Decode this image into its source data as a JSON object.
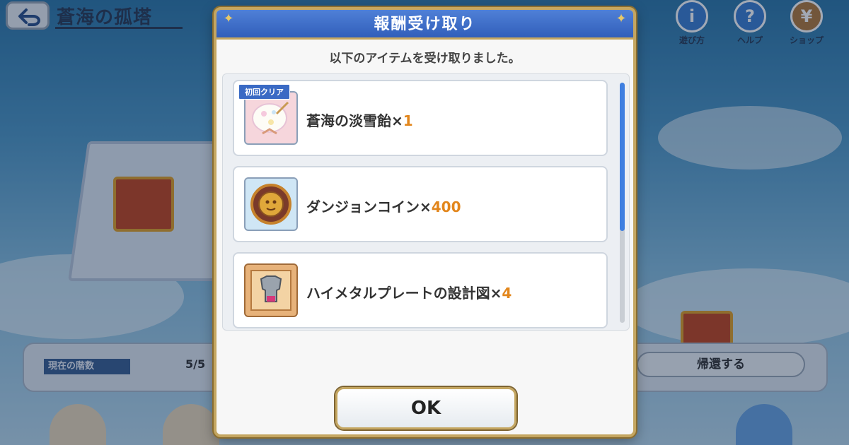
{
  "background": {
    "area_title": "蒼海の孤塔",
    "top_icons": [
      {
        "label": "遊び方",
        "icon": "info-icon",
        "glyph": "i"
      },
      {
        "label": "ヘルプ",
        "icon": "help-icon",
        "glyph": "?"
      },
      {
        "label": "ショップ",
        "icon": "shop-icon",
        "glyph": "¥"
      }
    ],
    "dungeon_label": "現在の階数",
    "dungeon_count": "5/5",
    "retreat_button": "帰還する"
  },
  "modal": {
    "title": "報酬受け取り",
    "subtitle": "以下のアイテムを受け取りました。",
    "ok_label": "OK",
    "items": [
      {
        "name": "蒼海の淡雪飴×",
        "qty": "1",
        "badge": "初回クリア",
        "icon": "snow-candy-icon"
      },
      {
        "name": "ダンジョンコイン×",
        "qty": "400",
        "icon": "dungeon-coin-icon"
      },
      {
        "name": "ハイメタルプレートの設計図×",
        "qty": "4",
        "icon": "armor-blueprint-icon"
      }
    ]
  },
  "colors": {
    "header_blue": "#2f5cb8",
    "gold_border": "#c4a661",
    "quantity_orange": "#e2861c",
    "scroll_thumb": "#3f7fe0"
  }
}
